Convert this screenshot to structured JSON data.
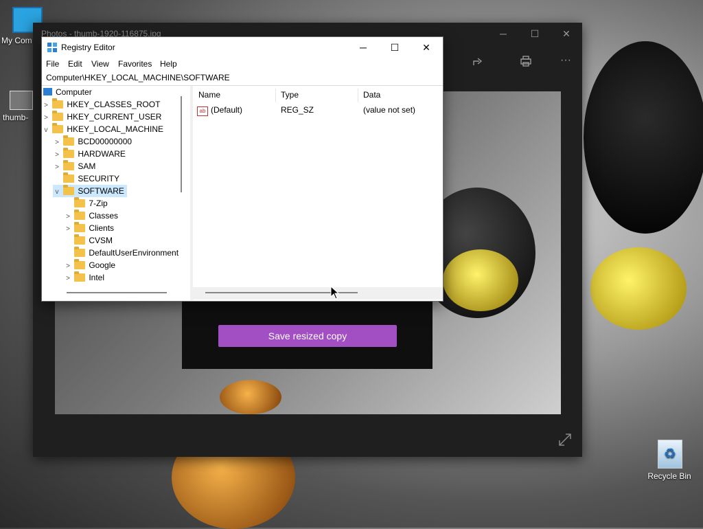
{
  "desktop": {
    "icons": [
      {
        "label": "My Com",
        "name": "my-computer"
      },
      {
        "label": "thumb-",
        "name": "thumb-file"
      },
      {
        "label": "Recycle Bin",
        "name": "recycle-bin"
      }
    ]
  },
  "photos": {
    "title": "Photos - thumb-1920-116875.jpg",
    "minimize": "─",
    "maximize": "☐",
    "close": "✕",
    "share_icon": "share-icon",
    "print_icon": "print-icon",
    "more": "···",
    "resize_dialog": {
      "save_button": "Save resized copy"
    }
  },
  "regedit": {
    "title": "Registry Editor",
    "minimize": "─",
    "maximize": "☐",
    "close": "✕",
    "menu": [
      "File",
      "Edit",
      "View",
      "Favorites",
      "Help"
    ],
    "address": "Computer\\HKEY_LOCAL_MACHINE\\SOFTWARE",
    "tree": {
      "root": "Computer",
      "hives": [
        "HKEY_CLASSES_ROOT",
        "HKEY_CURRENT_USER",
        "HKEY_LOCAL_MACHINE"
      ],
      "hklm_children": [
        "BCD00000000",
        "HARDWARE",
        "SAM",
        "SECURITY",
        "SOFTWARE"
      ],
      "software_children": [
        "7-Zip",
        "Classes",
        "Clients",
        "CVSM",
        "DefaultUserEnvironment",
        "Google",
        "Intel"
      ],
      "selected": "SOFTWARE"
    },
    "list": {
      "columns": [
        "Name",
        "Type",
        "Data"
      ],
      "rows": [
        {
          "name": "(Default)",
          "type": "REG_SZ",
          "data": "(value not set)"
        }
      ]
    }
  },
  "colors": {
    "accent_button": "#a24fc4",
    "selection": "#cce8ff",
    "folder": "#f3c24a"
  }
}
